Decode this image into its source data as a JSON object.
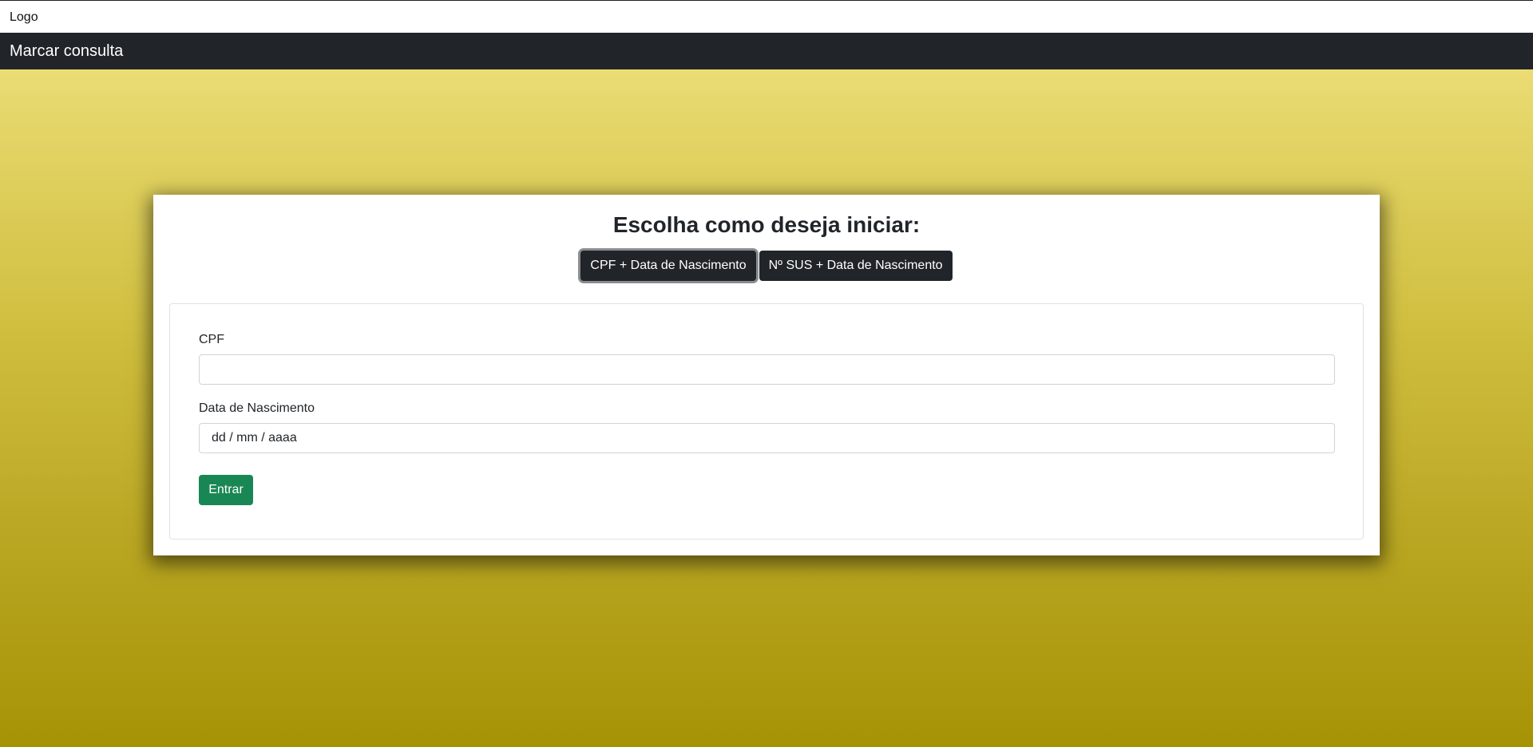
{
  "header": {
    "logo_text": "Logo"
  },
  "navbar": {
    "title": "Marcar consulta"
  },
  "main": {
    "title": "Escolha como deseja iniciar:",
    "options": [
      {
        "label": "CPF + Data de Nascimento",
        "active": true
      },
      {
        "label": "Nº SUS + Data de Nascimento",
        "active": false
      }
    ],
    "form": {
      "cpf_label": "CPF",
      "cpf_value": "",
      "birth_label": "Data de Nascimento",
      "birth_placeholder": "dd / mm / aaaa",
      "submit_label": "Entrar"
    }
  },
  "colors": {
    "navbar_bg": "#212529",
    "submit_bg": "#198754",
    "background_top": "#f2e581",
    "background_bottom": "#a69305"
  }
}
